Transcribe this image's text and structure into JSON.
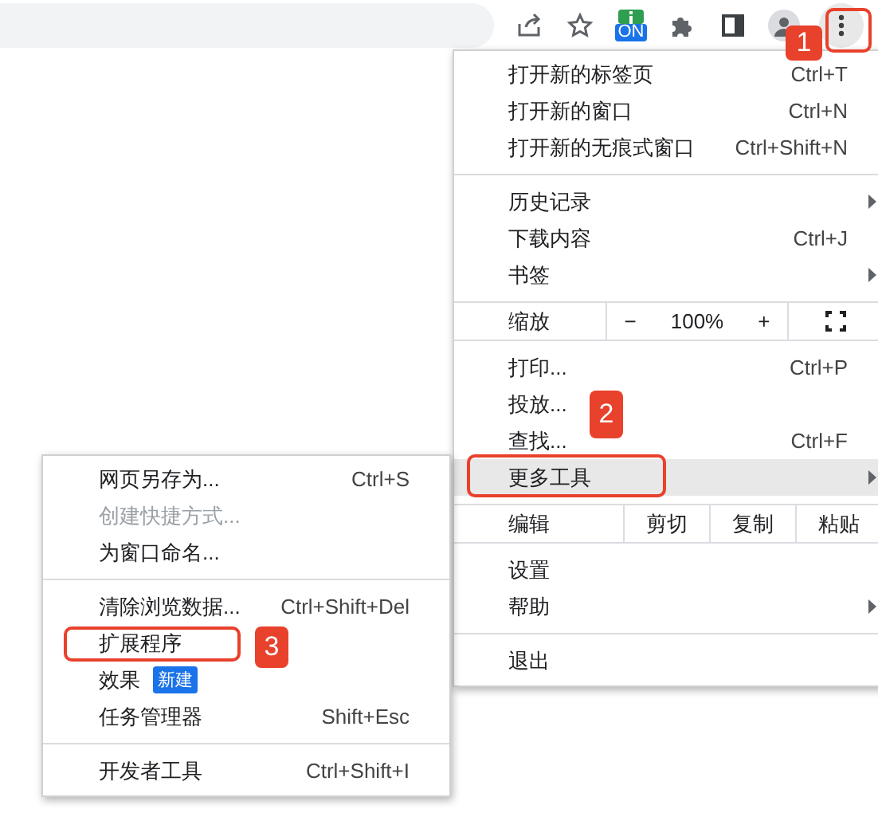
{
  "toolbar": {
    "extension_badge": "ON"
  },
  "menu": {
    "items": [
      {
        "kind": "item",
        "label": "打开新的标签页",
        "shortcut": "Ctrl+T",
        "has_submenu": false,
        "highlighted": false
      },
      {
        "kind": "item",
        "label": "打开新的窗口",
        "shortcut": "Ctrl+N",
        "has_submenu": false,
        "highlighted": false
      },
      {
        "kind": "item",
        "label": "打开新的无痕式窗口",
        "shortcut": "Ctrl+Shift+N",
        "has_submenu": false,
        "highlighted": false
      },
      {
        "kind": "separator"
      },
      {
        "kind": "item",
        "label": "历史记录",
        "has_submenu": true,
        "highlighted": false
      },
      {
        "kind": "item",
        "label": "下载内容",
        "shortcut": "Ctrl+J",
        "has_submenu": false,
        "highlighted": false
      },
      {
        "kind": "item",
        "label": "书签",
        "has_submenu": true,
        "highlighted": false
      },
      {
        "kind": "zoom",
        "label": "缩放",
        "minus": "−",
        "value": "100%",
        "plus": "+"
      },
      {
        "kind": "item",
        "label": "打印...",
        "shortcut": "Ctrl+P",
        "has_submenu": false,
        "highlighted": false
      },
      {
        "kind": "item",
        "label": "投放...",
        "has_submenu": false,
        "highlighted": false
      },
      {
        "kind": "item",
        "label": "查找...",
        "shortcut": "Ctrl+F",
        "has_submenu": false,
        "highlighted": false
      },
      {
        "kind": "item",
        "label": "更多工具",
        "has_submenu": true,
        "highlighted": true
      },
      {
        "kind": "edit",
        "label": "编辑",
        "actions": [
          "剪切",
          "复制",
          "粘贴"
        ]
      },
      {
        "kind": "item",
        "label": "设置",
        "has_submenu": false,
        "highlighted": false
      },
      {
        "kind": "item",
        "label": "帮助",
        "has_submenu": true,
        "highlighted": false
      },
      {
        "kind": "separator"
      },
      {
        "kind": "item",
        "label": "退出",
        "has_submenu": false,
        "highlighted": false
      }
    ]
  },
  "submenu": {
    "items": [
      {
        "kind": "item",
        "label": "网页另存为...",
        "shortcut": "Ctrl+S",
        "disabled": false
      },
      {
        "kind": "item",
        "label": "创建快捷方式...",
        "disabled": true
      },
      {
        "kind": "item",
        "label": "为窗口命名...",
        "disabled": false
      },
      {
        "kind": "separator"
      },
      {
        "kind": "item",
        "label": "清除浏览数据...",
        "shortcut": "Ctrl+Shift+Del",
        "disabled": false
      },
      {
        "kind": "item",
        "label": "扩展程序",
        "disabled": false
      },
      {
        "kind": "item",
        "label": "效果",
        "tag": "新建",
        "disabled": false
      },
      {
        "kind": "item",
        "label": "任务管理器",
        "shortcut": "Shift+Esc",
        "disabled": false
      },
      {
        "kind": "separator"
      },
      {
        "kind": "item",
        "label": "开发者工具",
        "shortcut": "Ctrl+Shift+I",
        "disabled": false
      }
    ]
  },
  "annotations": [
    {
      "label": "1"
    },
    {
      "label": "2"
    },
    {
      "label": "3"
    }
  ]
}
